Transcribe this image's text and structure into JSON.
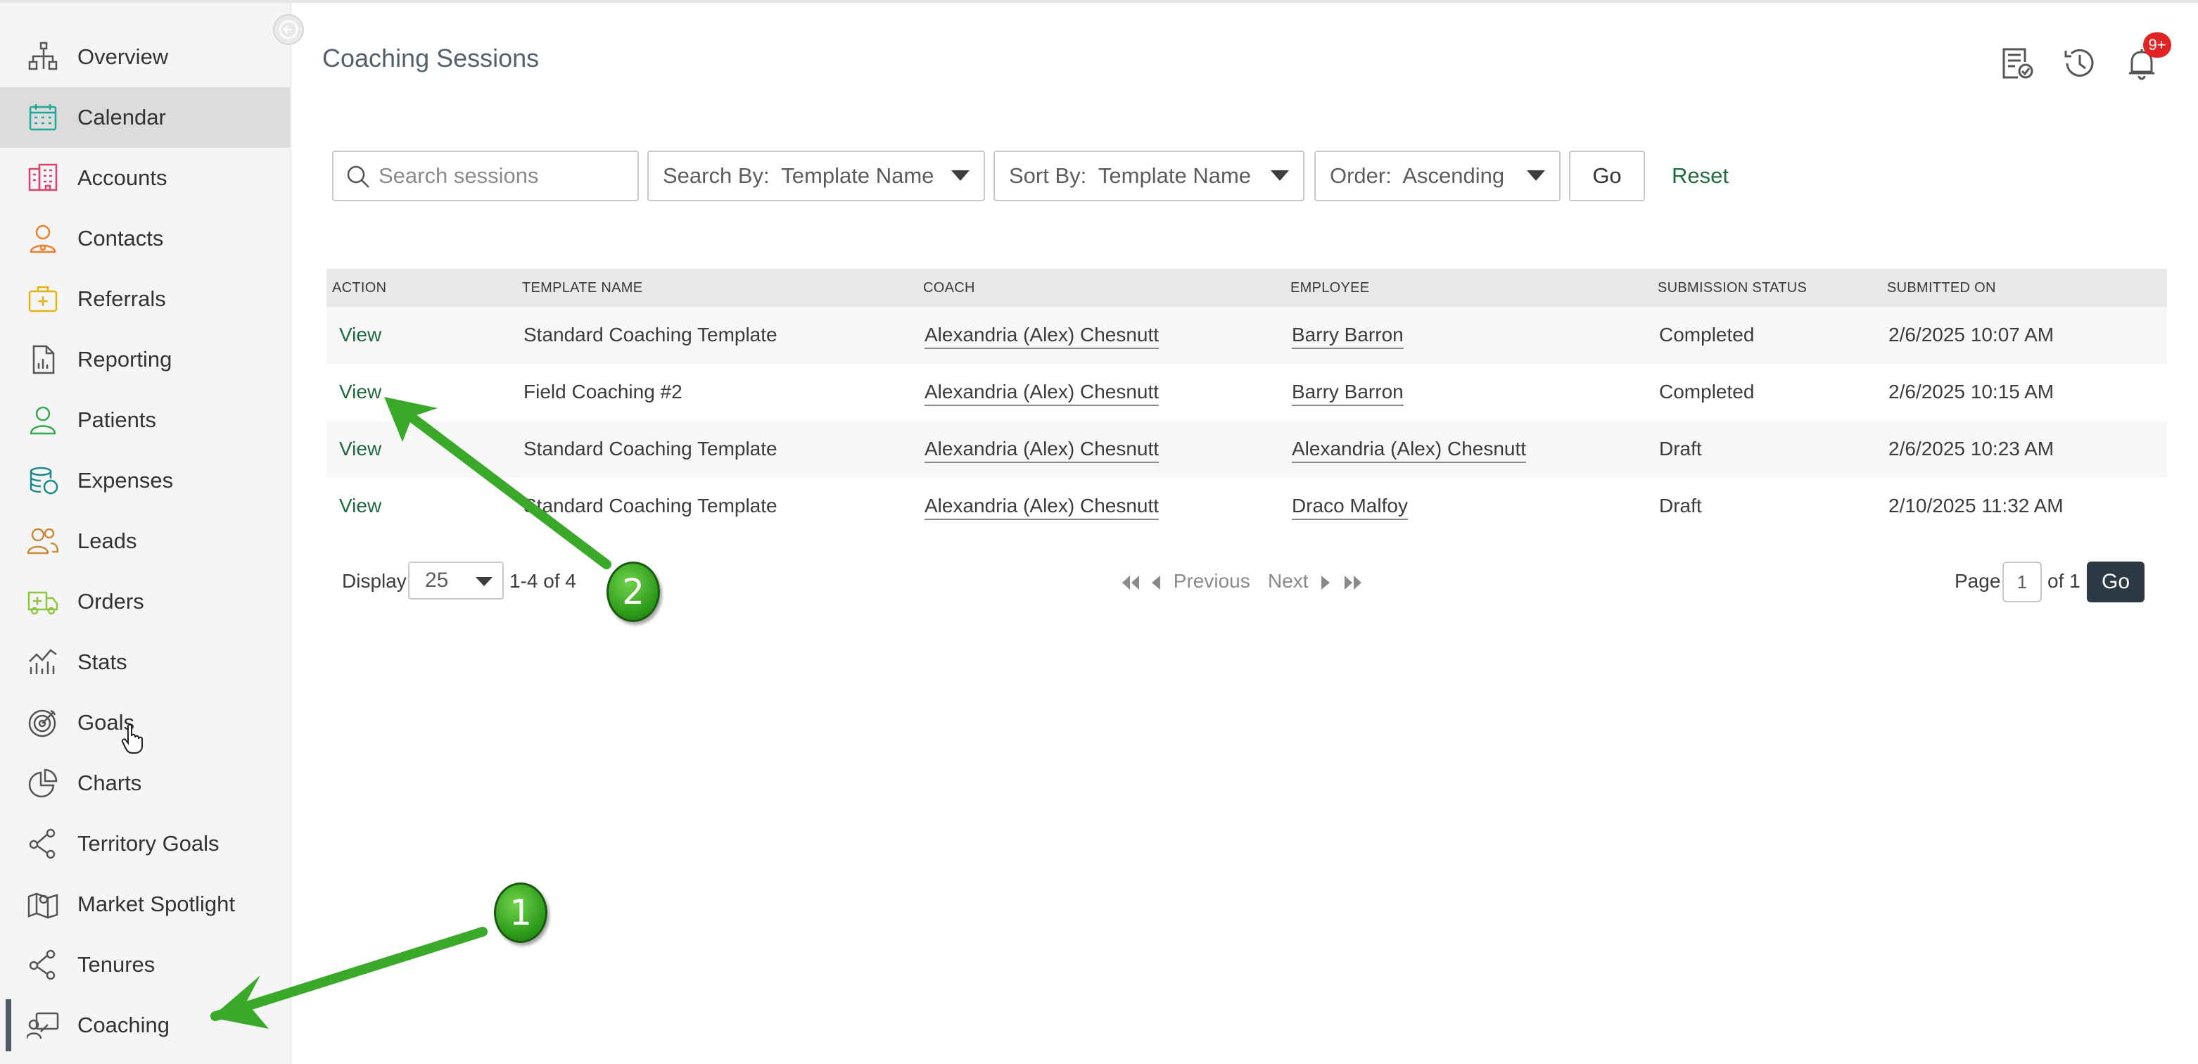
{
  "sidebar": {
    "items": [
      {
        "label": "Overview",
        "icon": "overview-icon"
      },
      {
        "label": "Calendar",
        "icon": "calendar-icon"
      },
      {
        "label": "Accounts",
        "icon": "accounts-icon"
      },
      {
        "label": "Contacts",
        "icon": "contacts-icon"
      },
      {
        "label": "Referrals",
        "icon": "referrals-icon"
      },
      {
        "label": "Reporting",
        "icon": "reporting-icon"
      },
      {
        "label": "Patients",
        "icon": "patients-icon"
      },
      {
        "label": "Expenses",
        "icon": "expenses-icon"
      },
      {
        "label": "Leads",
        "icon": "leads-icon"
      },
      {
        "label": "Orders",
        "icon": "orders-icon"
      },
      {
        "label": "Stats",
        "icon": "stats-icon"
      },
      {
        "label": "Goals",
        "icon": "goals-icon"
      },
      {
        "label": "Charts",
        "icon": "charts-icon"
      },
      {
        "label": "Territory Goals",
        "icon": "territory-goals-icon"
      },
      {
        "label": "Market Spotlight",
        "icon": "market-spotlight-icon"
      },
      {
        "label": "Tenures",
        "icon": "tenures-icon"
      },
      {
        "label": "Coaching",
        "icon": "coaching-icon"
      }
    ],
    "highlighted": "Calendar",
    "current": "Coaching"
  },
  "header": {
    "title": "Coaching Sessions",
    "notification_badge": "9+"
  },
  "filters": {
    "search_placeholder": "Search sessions",
    "search_by": "Search By:  Template Name",
    "sort_by": "Sort By:  Template Name",
    "order": "Order:  Ascending",
    "go_label": "Go",
    "reset_label": "Reset"
  },
  "table": {
    "columns": [
      "ACTION",
      "TEMPLATE NAME",
      "COACH",
      "EMPLOYEE",
      "SUBMISSION STATUS",
      "SUBMITTED ON"
    ],
    "rows": [
      {
        "action": "View",
        "template": "Standard Coaching Template",
        "coach": "Alexandria (Alex) Chesnutt",
        "employee": "Barry Barron",
        "status": "Completed",
        "submitted": "2/6/2025 10:07 AM"
      },
      {
        "action": "View",
        "template": "Field Coaching #2",
        "coach": "Alexandria (Alex) Chesnutt",
        "employee": "Barry Barron",
        "status": "Completed",
        "submitted": "2/6/2025 10:15 AM"
      },
      {
        "action": "View",
        "template": "Standard Coaching Template",
        "coach": "Alexandria (Alex) Chesnutt",
        "employee": "Alexandria (Alex) Chesnutt",
        "status": "Draft",
        "submitted": "2/6/2025 10:23 AM"
      },
      {
        "action": "View",
        "template": "Standard Coaching Template",
        "coach": "Alexandria (Alex) Chesnutt",
        "employee": "Draco Malfoy",
        "status": "Draft",
        "submitted": "2/10/2025 11:32 AM"
      }
    ]
  },
  "pagination": {
    "display_label": "Display",
    "page_size": "25",
    "range": "1-4 of 4",
    "previous": "Previous",
    "next": "Next",
    "page_label": "Page",
    "page_value": "1",
    "of_label": "of 1",
    "go_label": "Go"
  },
  "annotations": {
    "marker_1": "1",
    "marker_2": "2",
    "color": "#3aa829"
  },
  "colors": {
    "accent_green": "#1f6b3e",
    "dark_button": "#2d3a45",
    "badge_red": "#e02424"
  }
}
